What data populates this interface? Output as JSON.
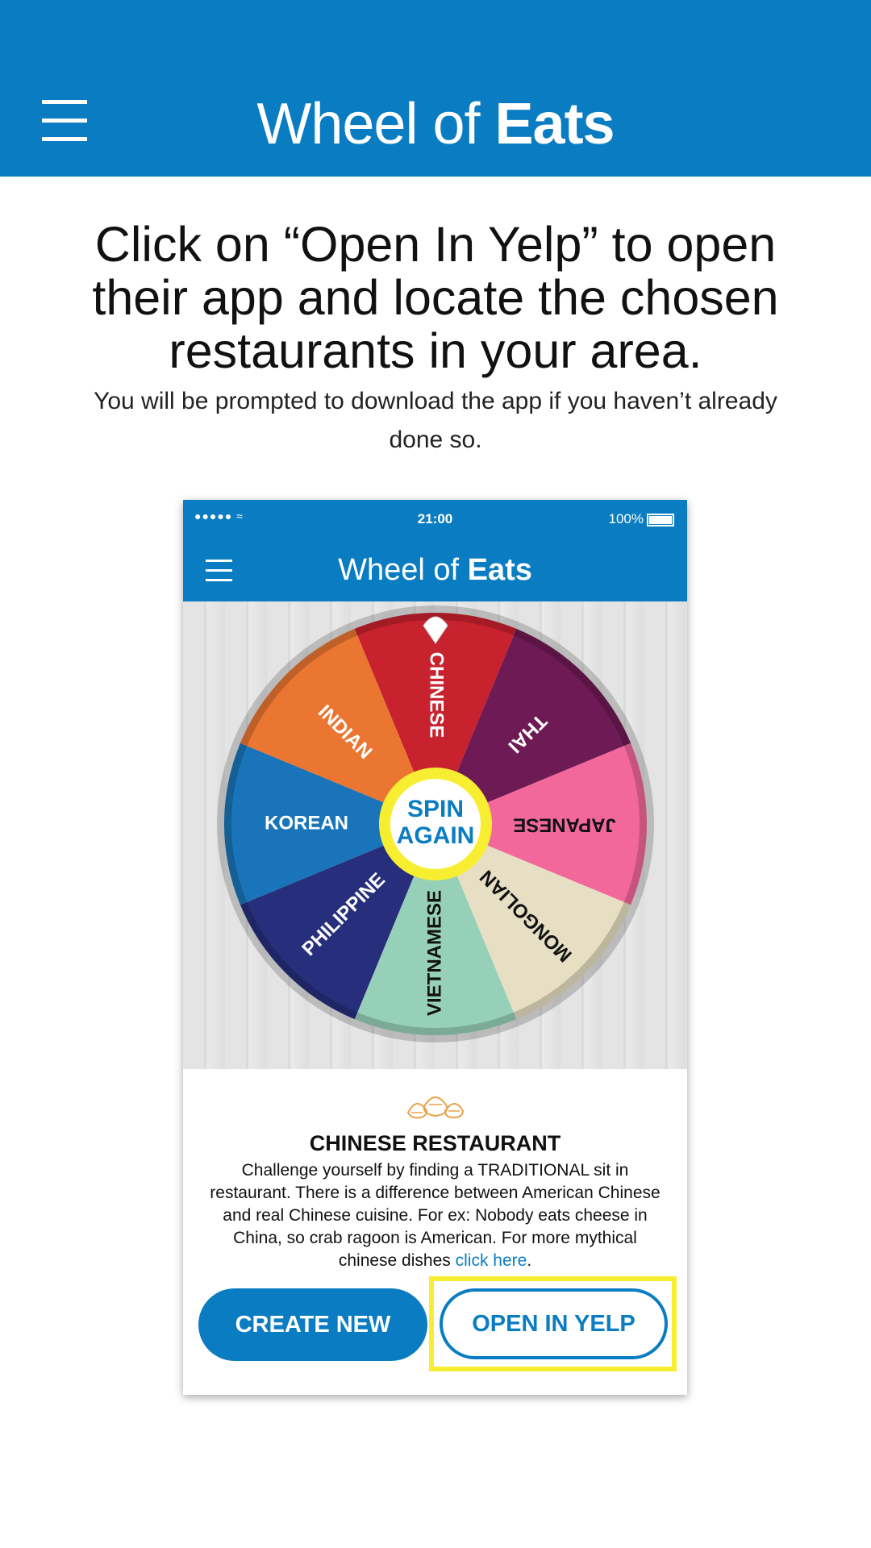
{
  "header": {
    "title_prefix": "Wheel of ",
    "title_bold": "Eats",
    "menu_icon": "hamburger-menu-icon",
    "background_color": "#0a7dc2"
  },
  "instructions": {
    "headline": "Click on “Open In Yelp” to open their app and locate the chosen restaurants in your area.",
    "subline": "You will be prompted to download the app if you haven’t already done so."
  },
  "phone": {
    "status": {
      "signal_dots": "●●●●● ≈",
      "time": "21:00",
      "battery": "100%"
    },
    "nav": {
      "title_prefix": "Wheel of ",
      "title_bold": "Eats"
    },
    "wheel": {
      "center_label_line1": "SPIN",
      "center_label_line2": "AGAIN",
      "segments": [
        {
          "label": "CHINESE",
          "color": "#c8222f",
          "text_color": "#ffffff"
        },
        {
          "label": "THAI",
          "color": "#6e1a55",
          "text_color": "#ffffff"
        },
        {
          "label": "JAPANESE",
          "color": "#f2689a",
          "text_color": "#111111"
        },
        {
          "label": "MONGOLIAN",
          "color": "#e7dfc3",
          "text_color": "#111111"
        },
        {
          "label": "VIETNAMESE",
          "color": "#97d0b8",
          "text_color": "#111111"
        },
        {
          "label": "PHILIPPINE",
          "color": "#272f7c",
          "text_color": "#ffffff"
        },
        {
          "label": "KOREAN",
          "color": "#1a74b9",
          "text_color": "#ffffff"
        },
        {
          "label": "INDIAN",
          "color": "#ea7631",
          "text_color": "#ffffff"
        }
      ]
    },
    "result": {
      "icon": "dumplings-icon",
      "title": "CHINESE RESTAURANT",
      "body": "Challenge yourself by finding a TRADITIONAL sit in restaurant. There is a difference between American Chinese and real Chinese cuisine. For ex: Nobody eats cheese in China, so crab ragoon is American. For more mythical chinese dishes ",
      "link": "click here",
      "after_link": "."
    },
    "buttons": {
      "create_new": "CREATE NEW",
      "open_in_yelp": "OPEN IN YELP"
    },
    "highlight_color": "#f7ee32"
  }
}
